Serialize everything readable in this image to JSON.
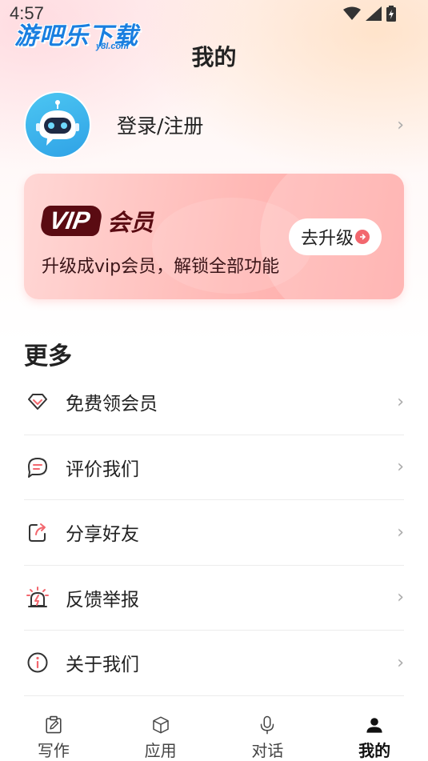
{
  "status_bar": {
    "time": "4:57"
  },
  "watermark": {
    "main": "游吧乐下载",
    "sub": "y8l.com"
  },
  "header": {
    "title": "我的"
  },
  "profile": {
    "login_label": "登录/注册"
  },
  "vip": {
    "badge": "VIP",
    "title": "会员",
    "description": "升级成vip会员，解锁全部功能",
    "upgrade_label": "去升级"
  },
  "more": {
    "title": "更多",
    "items": [
      {
        "label": "免费领会员",
        "icon": "diamond-icon"
      },
      {
        "label": "评价我们",
        "icon": "chat-bubble-icon"
      },
      {
        "label": "分享好友",
        "icon": "share-icon"
      },
      {
        "label": "反馈举报",
        "icon": "alarm-icon"
      },
      {
        "label": "关于我们",
        "icon": "info-icon"
      }
    ]
  },
  "tabbar": {
    "tabs": [
      {
        "label": "写作",
        "icon": "edit-icon"
      },
      {
        "label": "应用",
        "icon": "cube-icon"
      },
      {
        "label": "对话",
        "icon": "microphone-icon"
      },
      {
        "label": "我的",
        "icon": "person-icon"
      }
    ],
    "active_index": 3
  },
  "colors": {
    "accent": "#f2676e",
    "vip_dark": "#5a0b12",
    "avatar": "#3cb4ee"
  }
}
